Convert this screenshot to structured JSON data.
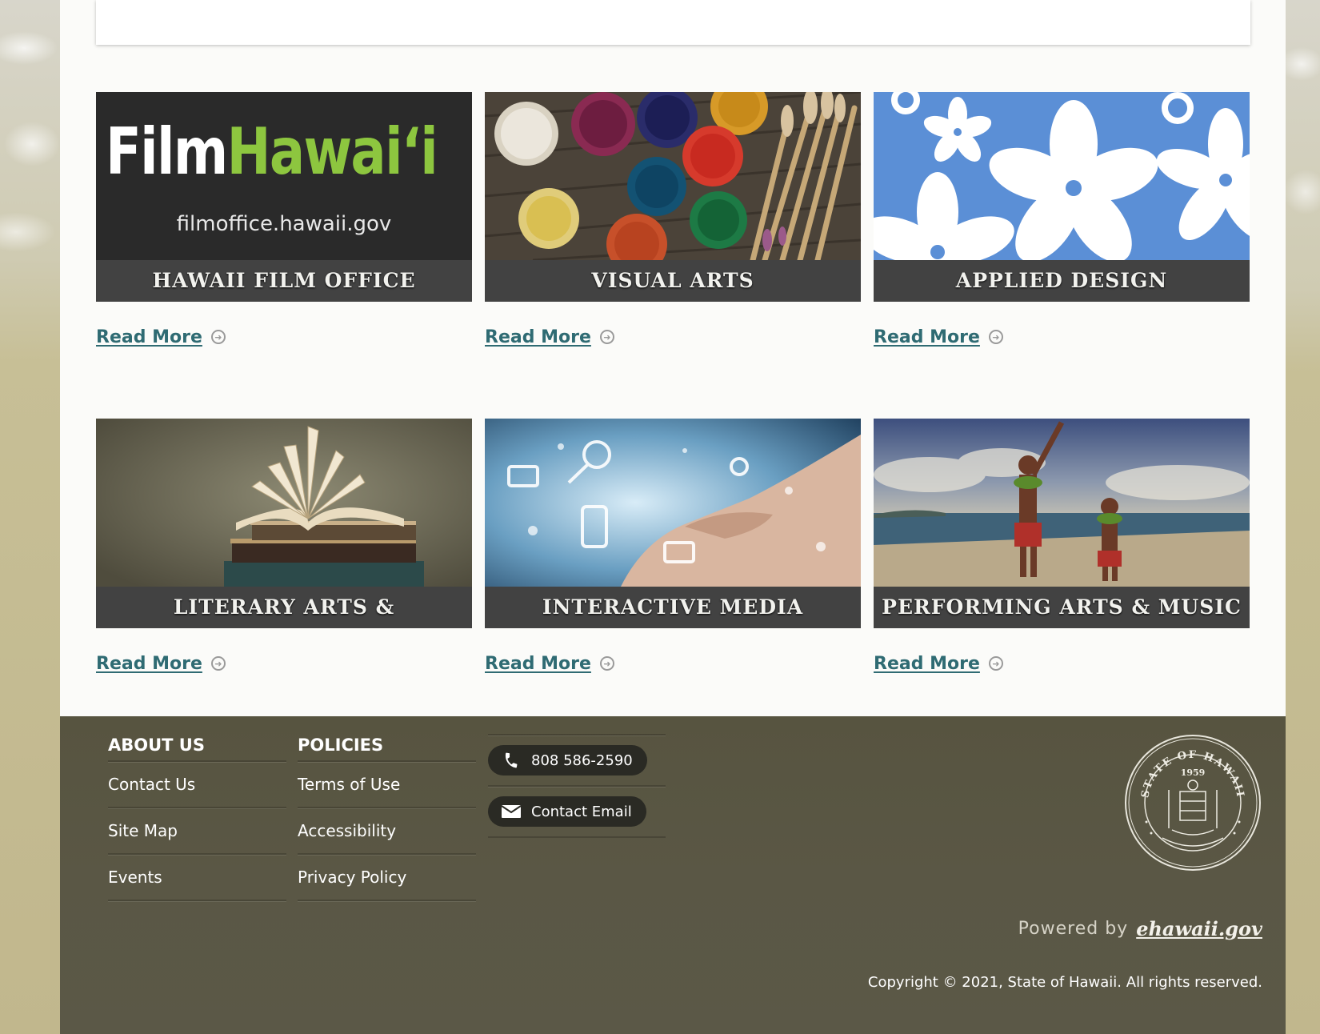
{
  "tiles": [
    {
      "caption": "HAWAII FILM OFFICE",
      "logo_film": "Film",
      "logo_hawaii": "Hawai‘i",
      "logo_url": "filmoffice.hawaii.gov",
      "read_more": "Read More"
    },
    {
      "caption": "VISUAL ARTS",
      "read_more": "Read More"
    },
    {
      "caption": "APPLIED DESIGN",
      "read_more": "Read More"
    },
    {
      "caption": "LITERARY ARTS & PUBLISHING",
      "read_more": "Read More"
    },
    {
      "caption": "INTERACTIVE MEDIA",
      "read_more": "Read More"
    },
    {
      "caption": "PERFORMING ARTS & MUSIC",
      "read_more": "Read More"
    }
  ],
  "footer": {
    "about": {
      "heading": "ABOUT US",
      "links": [
        "Contact Us",
        "Site Map",
        "Events"
      ]
    },
    "policies": {
      "heading": "POLICIES",
      "links": [
        "Terms of Use",
        "Accessibility",
        "Privacy Policy"
      ]
    },
    "contact": {
      "phone": "808 586-2590",
      "email_label": "Contact Email"
    },
    "seal": {
      "ring_text": "STATE OF HAWAII",
      "year": "1959"
    },
    "powered_by": {
      "prefix": "Powered by",
      "brand": "ehawaii.gov"
    },
    "copyright": "Copyright © 2021, State of Hawaii. All rights reserved."
  },
  "colors": {
    "link": "#2f6b73",
    "footer_bg": "#575440",
    "film_green": "#8dc63f",
    "applied_blue": "#5b8fd6"
  }
}
